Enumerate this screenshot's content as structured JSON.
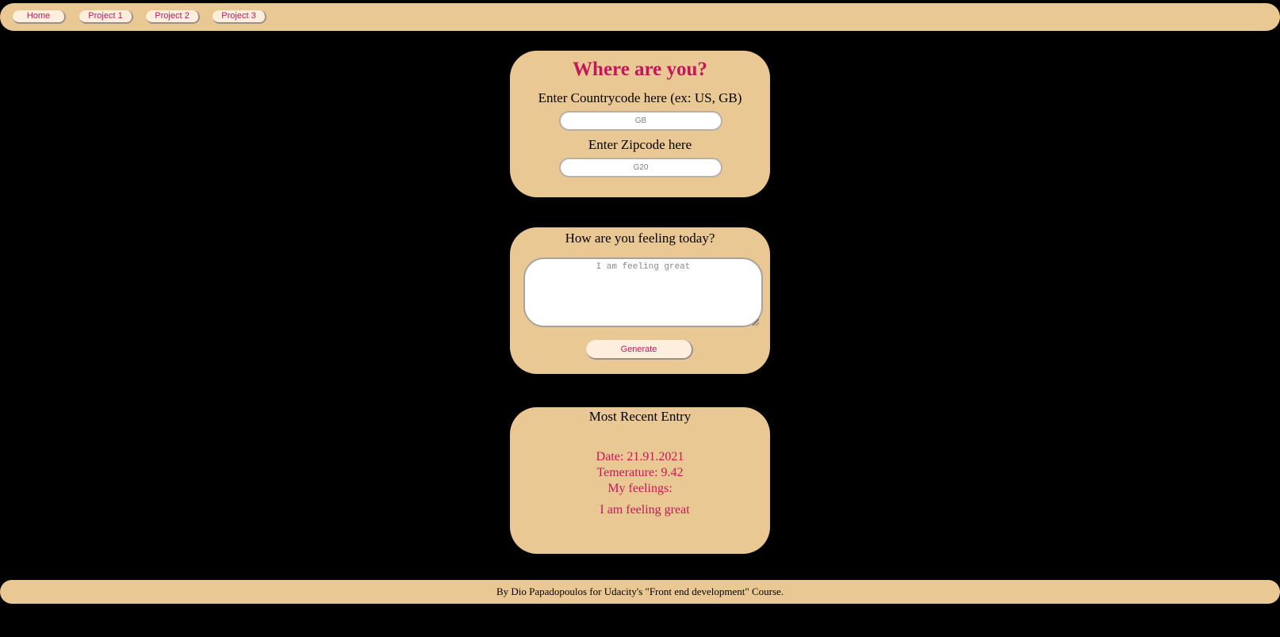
{
  "nav": {
    "items": [
      {
        "label": "Home"
      },
      {
        "label": "Project 1"
      },
      {
        "label": "Project 2"
      },
      {
        "label": "Project 3"
      }
    ]
  },
  "location": {
    "title": "Where are you?",
    "country_label": "Enter Countrycode here (ex: US, GB)",
    "country_placeholder": "GB",
    "zip_label": "Enter Zipcode here",
    "zip_placeholder": "G20"
  },
  "feelings": {
    "title": "How are you feeling today?",
    "placeholder": "I am feeling great",
    "generate_label": "Generate"
  },
  "entry": {
    "title": "Most Recent Entry",
    "date": "Date: 21.91.2021",
    "temperature": "Temerature: 9.42",
    "feelings_label": "My feelings:",
    "feelings_text": "I am feeling great"
  },
  "footer": {
    "text": "By Dio Papadopoulos for Udacity's \"Front end development\" Course."
  },
  "colors": {
    "background": "#000000",
    "panel": "#eac893",
    "accent": "#c2185b",
    "button": "#fdeede"
  }
}
